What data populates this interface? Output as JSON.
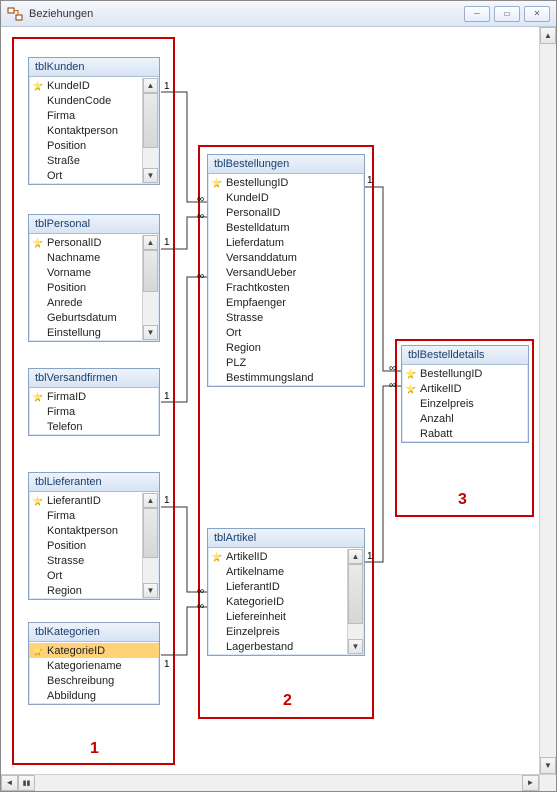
{
  "window": {
    "title": "Beziehungen"
  },
  "groups": {
    "g1": "1",
    "g2": "2",
    "g3": "3"
  },
  "tables": {
    "kunden": {
      "title": "tblKunden",
      "fields": [
        "KundeID",
        "KundenCode",
        "Firma",
        "Kontaktperson",
        "Position",
        "Straße",
        "Ort"
      ]
    },
    "personal": {
      "title": "tblPersonal",
      "fields": [
        "PersonalID",
        "Nachname",
        "Vorname",
        "Position",
        "Anrede",
        "Geburtsdatum",
        "Einstellung"
      ]
    },
    "versandfirmen": {
      "title": "tblVersandfirmen",
      "fields": [
        "FirmaID",
        "Firma",
        "Telefon"
      ]
    },
    "lieferanten": {
      "title": "tblLieferanten",
      "fields": [
        "LieferantID",
        "Firma",
        "Kontaktperson",
        "Position",
        "Strasse",
        "Ort",
        "Region"
      ]
    },
    "kategorien": {
      "title": "tblKategorien",
      "fields": [
        "KategorieID",
        "Kategoriename",
        "Beschreibung",
        "Abbildung"
      ]
    },
    "bestellungen": {
      "title": "tblBestellungen",
      "fields": [
        "BestellungID",
        "KundeID",
        "PersonalID",
        "Bestelldatum",
        "Lieferdatum",
        "Versanddatum",
        "VersandUeber",
        "Frachtkosten",
        "Empfaenger",
        "Strasse",
        "Ort",
        "Region",
        "PLZ",
        "Bestimmungsland"
      ]
    },
    "artikel": {
      "title": "tblArtikel",
      "fields": [
        "ArtikelID",
        "Artikelname",
        "LieferantID",
        "KategorieID",
        "Liefereinheit",
        "Einzelpreis",
        "Lagerbestand"
      ]
    },
    "bestelldetails": {
      "title": "tblBestelldetails",
      "fields": [
        "BestellungID",
        "ArtikelID",
        "Einzelpreis",
        "Anzahl",
        "Rabatt"
      ]
    }
  },
  "cardinality": {
    "one": "1",
    "many": "∞"
  }
}
